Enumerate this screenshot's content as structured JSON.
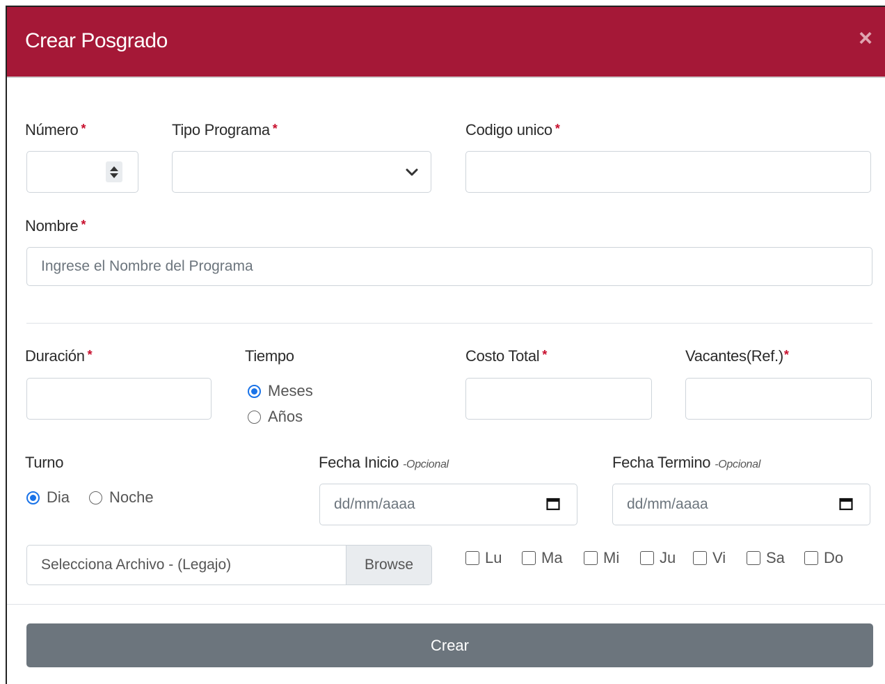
{
  "modal": {
    "title": "Crear Posgrado",
    "close_symbol": "×"
  },
  "fields": {
    "numero": {
      "label": "Número",
      "required_mark": "*",
      "value": ""
    },
    "tipo_programa": {
      "label": "Tipo Programa",
      "required_mark": "*",
      "selected": ""
    },
    "codigo_unico": {
      "label": "Codigo unico",
      "required_mark": "*",
      "value": ""
    },
    "nombre": {
      "label": "Nombre",
      "required_mark": "*",
      "placeholder": "Ingrese el Nombre del Programa"
    },
    "duracion": {
      "label": "Duración",
      "required_mark": "*",
      "value": ""
    },
    "tiempo": {
      "label": "Tiempo",
      "options": [
        "Meses",
        "Años"
      ],
      "selected": "Meses"
    },
    "costo_total": {
      "label": "Costo Total",
      "required_mark": "*",
      "value": ""
    },
    "vacantes": {
      "label": "Vacantes(Ref.)",
      "required_mark": "*",
      "value": ""
    },
    "turno": {
      "label": "Turno",
      "options": [
        "Dia",
        "Noche"
      ],
      "selected": "Dia"
    },
    "fecha_inicio": {
      "label": "Fecha Inicio",
      "optional_note": "-Opcional",
      "placeholder": "dd/mm/aaaa"
    },
    "fecha_termino": {
      "label": "Fecha Termino",
      "optional_note": "-Opcional",
      "placeholder": "dd/mm/aaaa"
    },
    "archivo": {
      "placeholder": "Selecciona Archivo - (Legajo)",
      "browse_label": "Browse"
    },
    "dias": [
      "Lu",
      "Ma",
      "Mi",
      "Ju",
      "Vi",
      "Sa",
      "Do"
    ]
  },
  "actions": {
    "submit_label": "Crear"
  },
  "colors": {
    "header": "#a51837",
    "radio_accent": "#1a73e8",
    "button": "#6c757d",
    "required": "#c8102e"
  }
}
